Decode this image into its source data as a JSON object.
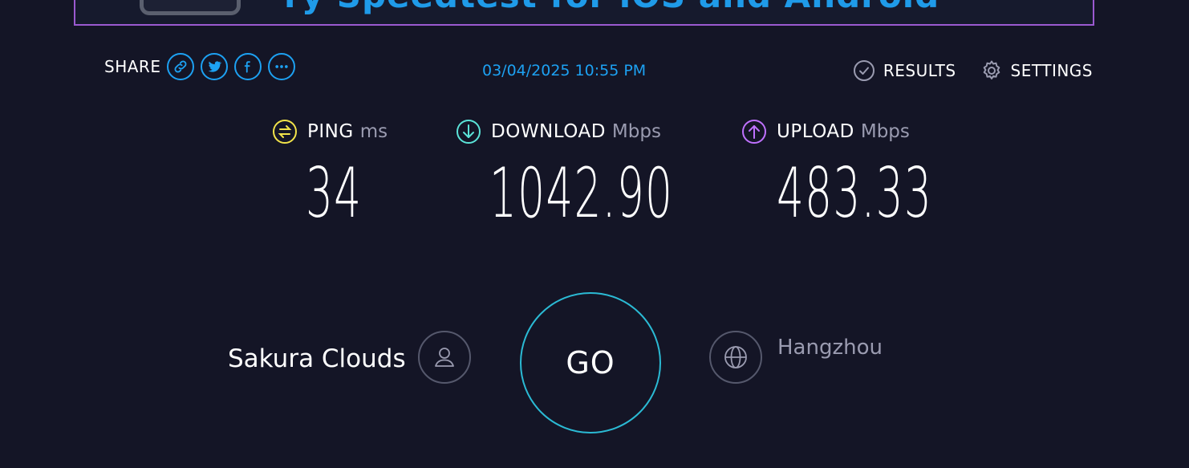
{
  "banner": {
    "text": "ry Speedtest for iOS and Android"
  },
  "share": {
    "label": "SHARE",
    "buttons": [
      {
        "icon": "link-icon"
      },
      {
        "icon": "twitter-icon"
      },
      {
        "icon": "facebook-icon"
      },
      {
        "icon": "more-icon"
      }
    ]
  },
  "datetime": "03/04/2025 10:55 PM",
  "nav": {
    "results_label": "RESULTS",
    "settings_label": "SETTINGS"
  },
  "metrics": {
    "ping": {
      "name": "PING",
      "unit": "ms",
      "value": "34",
      "color": "#f2e34a"
    },
    "download": {
      "name": "DOWNLOAD",
      "unit": "Mbps",
      "value": "1042.90",
      "color": "#5be3d8"
    },
    "upload": {
      "name": "UPLOAD",
      "unit": "Mbps",
      "value": "483.33",
      "color": "#bf71ff"
    }
  },
  "server": {
    "provider": "Sakura Clouds",
    "location": "Hangzhou"
  },
  "go_button": {
    "label": "GO"
  },
  "colors": {
    "background": "#141526",
    "accent": "#1da1f2",
    "go_ring": "#2bbad4"
  }
}
